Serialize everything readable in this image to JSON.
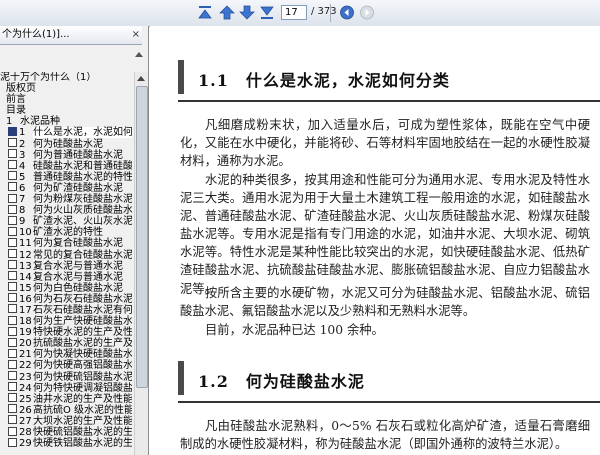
{
  "toolbar": {
    "page_current": "17",
    "page_total": "/ 373",
    "icons": [
      "first-page-icon",
      "prev-page-icon",
      "next-page-icon",
      "last-page-icon",
      "back-icon",
      "forward-icon"
    ]
  },
  "panel": {
    "tab_title": "个为什么(1)]...",
    "close_glyph": "×",
    "bookmarks": [
      {
        "num": "",
        "label": "泥十万个为什么（1）",
        "indent": 0,
        "box": false
      },
      {
        "num": "",
        "label": "版权页",
        "indent": 1,
        "box": false
      },
      {
        "num": "",
        "label": "前言",
        "indent": 1,
        "box": false
      },
      {
        "num": "",
        "label": "目录",
        "indent": 1,
        "box": false
      },
      {
        "num": "1",
        "label": "水泥品种",
        "indent": 1,
        "box": false
      },
      {
        "num": "1",
        "label": "什么是水泥，水泥如何分",
        "indent": 2,
        "box": true,
        "selected": true
      },
      {
        "num": "2",
        "label": "何为硅酸盐水泥",
        "indent": 2,
        "box": true
      },
      {
        "num": "3",
        "label": "何为普通硅酸盐水泥",
        "indent": 2,
        "box": true
      },
      {
        "num": "4",
        "label": "硅酸盐水泥和普通硅酸",
        "indent": 2,
        "box": true
      },
      {
        "num": "5",
        "label": "普通硅酸盐水泥的特性",
        "indent": 2,
        "box": true
      },
      {
        "num": "6",
        "label": "何为矿渣硅酸盐水泥",
        "indent": 2,
        "box": true
      },
      {
        "num": "7",
        "label": "何为粉煤灰硅酸盐水泥",
        "indent": 2,
        "box": true
      },
      {
        "num": "8",
        "label": "何为火山灰质硅酸盐水",
        "indent": 2,
        "box": true
      },
      {
        "num": "9",
        "label": "矿渣水泥、火山灰水泥",
        "indent": 2,
        "box": true
      },
      {
        "num": "10",
        "label": "矿渣水泥的特性",
        "indent": 2,
        "box": true
      },
      {
        "num": "11",
        "label": "何为复合硅酸盐水泥",
        "indent": 2,
        "box": true
      },
      {
        "num": "12",
        "label": "常见的复合硅酸盐水泥",
        "indent": 2,
        "box": true
      },
      {
        "num": "13",
        "label": "复合水泥与普通水泥",
        "indent": 2,
        "box": true
      },
      {
        "num": "14",
        "label": "复合水泥与普通水泥",
        "indent": 2,
        "box": true
      },
      {
        "num": "15",
        "label": "何为白色硅酸盐水泥",
        "indent": 2,
        "box": true
      },
      {
        "num": "16",
        "label": "何为石灰石硅酸盐水泥",
        "indent": 2,
        "box": true
      },
      {
        "num": "17",
        "label": "石灰石硅酸盐水泥有何",
        "indent": 2,
        "box": true
      },
      {
        "num": "18",
        "label": "何为生产快硬硅酸盐水",
        "indent": 2,
        "box": true
      },
      {
        "num": "19",
        "label": "特快硬水泥的生产及性",
        "indent": 2,
        "box": true
      },
      {
        "num": "20",
        "label": "抗硫酸盐水泥的生产及",
        "indent": 2,
        "box": true
      },
      {
        "num": "21",
        "label": "何为快凝快硬硅酸盐水",
        "indent": 2,
        "box": true
      },
      {
        "num": "22",
        "label": "何为快硬高强铝酸盐水",
        "indent": 2,
        "box": true
      },
      {
        "num": "23",
        "label": "何为快硬硫铝酸盐水泥",
        "indent": 2,
        "box": true
      },
      {
        "num": "24",
        "label": "何为特快硬调凝铝酸盐",
        "indent": 2,
        "box": true
      },
      {
        "num": "25",
        "label": "油井水泥的生产及性能",
        "indent": 2,
        "box": true
      },
      {
        "num": "26",
        "label": "高抗硫O 级水泥的性能",
        "indent": 2,
        "box": true
      },
      {
        "num": "27",
        "label": "大坝水泥的生产及性能",
        "indent": 2,
        "box": true
      },
      {
        "num": "28",
        "label": "快硬硫铝酸盐水泥的生",
        "indent": 2,
        "box": true
      },
      {
        "num": "29",
        "label": "快硬铁铝酸盐水泥的生",
        "indent": 2,
        "box": true
      }
    ]
  },
  "document": {
    "section1": {
      "title": "1.1　什么是水泥，水泥如何分类",
      "paragraphs": [
        "凡细磨成粉末状，加入适量水后，可成为塑性浆体，既能在空气中硬化，又能在水中硬化，并能将砂、石等材料牢固地胶结在一起的水硬性胶凝材料，通称为水泥。",
        "水泥的种类很多，按其用途和性能可分为通用水泥、专用水泥及特性水泥三大类。通用水泥为用于大量土木建筑工程一般用途的水泥，如硅酸盐水泥、普通硅酸盐水泥、矿渣硅酸盐水泥、火山灰质硅酸盐水泥、粉煤灰硅酸盐水泥等。专用水泥是指有专门用途的水泥，如油井水泥、大坝水泥、砌筑水泥等。特性水泥是某种性能比较突出的水泥，如快硬硅酸盐水泥、低热矿渣硅酸盐水泥、抗硫酸盐硅酸盐水泥、膨胀硫铝酸盐水泥、自应力铝酸盐水泥等。",
        "按所含主要的水硬矿物，水泥又可分为硅酸盐水泥、铝酸盐水泥、硫铝酸盐水泥、氟铝酸盐水泥以及少熟料和无熟料水泥等。",
        "目前，水泥品种已达 100 余种。"
      ]
    },
    "section2": {
      "title": "1.2　何为硅酸盐水泥",
      "paragraphs": [
        "凡由硅酸盐水泥熟料，0～5% 石灰石或粒化高炉矿渣，适量石膏磨细制成的水硬性胶凝材料，称为硅酸盐水泥（即国外通称的波特兰水泥）。"
      ]
    }
  }
}
